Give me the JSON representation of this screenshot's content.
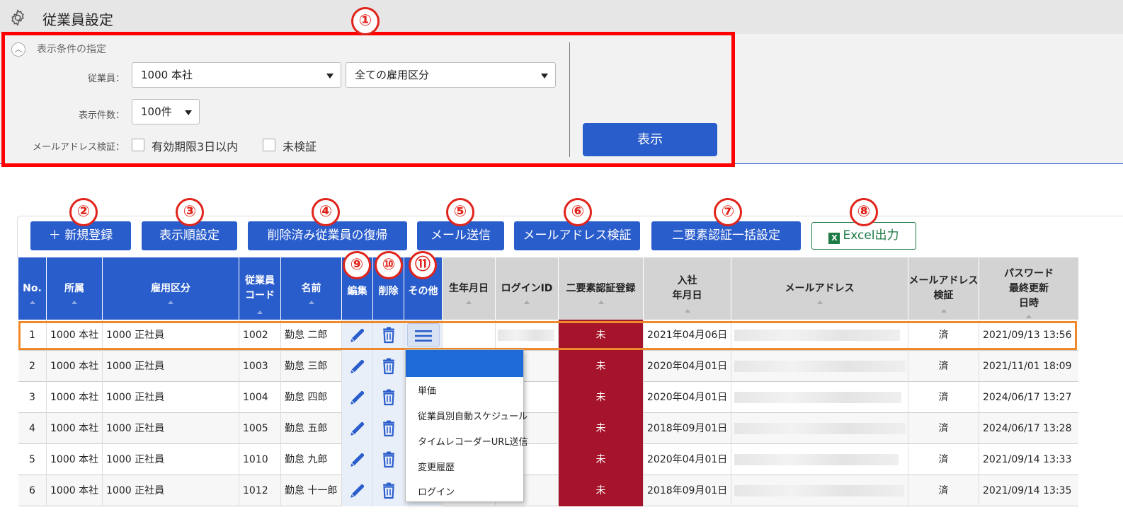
{
  "header": {
    "title": "従業員設定",
    "icon": "gear-icon"
  },
  "filter": {
    "heading": "表示条件の指定",
    "employee_label": "従業員：",
    "employee_value": "1000 本社",
    "employment_value": "全ての雇用区分",
    "count_label": "表示件数：",
    "count_value": "100件",
    "email_check_label": "メールアドレス検証：",
    "check_within3days": "有効期限3日以内",
    "check_unverified": "未検証",
    "show_button": "表示"
  },
  "callouts": [
    "①",
    "②",
    "③",
    "④",
    "⑤",
    "⑥",
    "⑦",
    "⑧",
    "⑨",
    "⑩",
    "⑪"
  ],
  "toolbar": {
    "new_register": "新規登録",
    "display_order": "表示順設定",
    "restore_deleted": "削除済み従業員の復帰",
    "send_mail": "メール送信",
    "verify_email": "メールアドレス検証",
    "bulk_2fa": "二要素認証一括設定",
    "excel_export": "Excel出力"
  },
  "table": {
    "headers": {
      "no": "No.",
      "affiliation": "所属",
      "employment": "雇用区分",
      "code_l1": "従業員",
      "code_l2": "コード",
      "name": "名前",
      "edit": "編集",
      "delete": "削除",
      "other": "その他",
      "birth": "生年月日",
      "login_id": "ログインID",
      "mfa": "二要素認証登録",
      "join_l1": "入社",
      "join_l2": "年月日",
      "email": "メールアドレス",
      "verify_l1": "メールアドレス",
      "verify_l2": "検証",
      "pwd_l1": "パスワード",
      "pwd_l2": "最終更新",
      "pwd_l3": "日時"
    },
    "rows": [
      {
        "no": "1",
        "affiliation": "1000 本社",
        "employment": "1000 正社員",
        "code": "1002",
        "name": "勤怠 二郎",
        "mfa": "未",
        "joined": "2021年04月06日",
        "verified": "済",
        "pwd_updated": "2021/09/13 13:56"
      },
      {
        "no": "2",
        "affiliation": "1000 本社",
        "employment": "1000 正社員",
        "code": "1003",
        "name": "勤怠 三郎",
        "mfa": "未",
        "joined": "2020年04月01日",
        "verified": "済",
        "pwd_updated": "2021/11/01 18:09"
      },
      {
        "no": "3",
        "affiliation": "1000 本社",
        "employment": "1000 正社員",
        "code": "1004",
        "name": "勤怠 四郎",
        "mfa": "未",
        "joined": "2020年04月01日",
        "verified": "済",
        "pwd_updated": "2024/06/17 13:27"
      },
      {
        "no": "4",
        "affiliation": "1000 本社",
        "employment": "1000 正社員",
        "code": "1005",
        "name": "勤怠 五郎",
        "mfa": "未",
        "joined": "2018年09月01日",
        "verified": "済",
        "pwd_updated": "2024/06/17 13:28"
      },
      {
        "no": "5",
        "affiliation": "1000 本社",
        "employment": "1000 正社員",
        "code": "1010",
        "name": "勤怠 九郎",
        "mfa": "未",
        "joined": "2020年04月01日",
        "verified": "済",
        "pwd_updated": "2021/09/14 13:33"
      },
      {
        "no": "6",
        "affiliation": "1000 本社",
        "employment": "1000 正社員",
        "code": "1012",
        "name": "勤怠 十一郎",
        "mfa": "未",
        "joined": "2018年09月01日",
        "verified": "済",
        "pwd_updated": "2021/09/14 13:35"
      }
    ]
  },
  "other_menu": {
    "items": [
      "単価",
      "従業員別自動スケジュール",
      "タイムレコーダーURL送信",
      "変更履歴",
      "ログイン"
    ]
  },
  "colors": {
    "accent": "#2a5dcc",
    "mfa_unregistered": "#a5142a",
    "highlight_red": "#ff0000",
    "row_highlight": "#ef8a2c",
    "excel_green": "#1e7a45"
  }
}
